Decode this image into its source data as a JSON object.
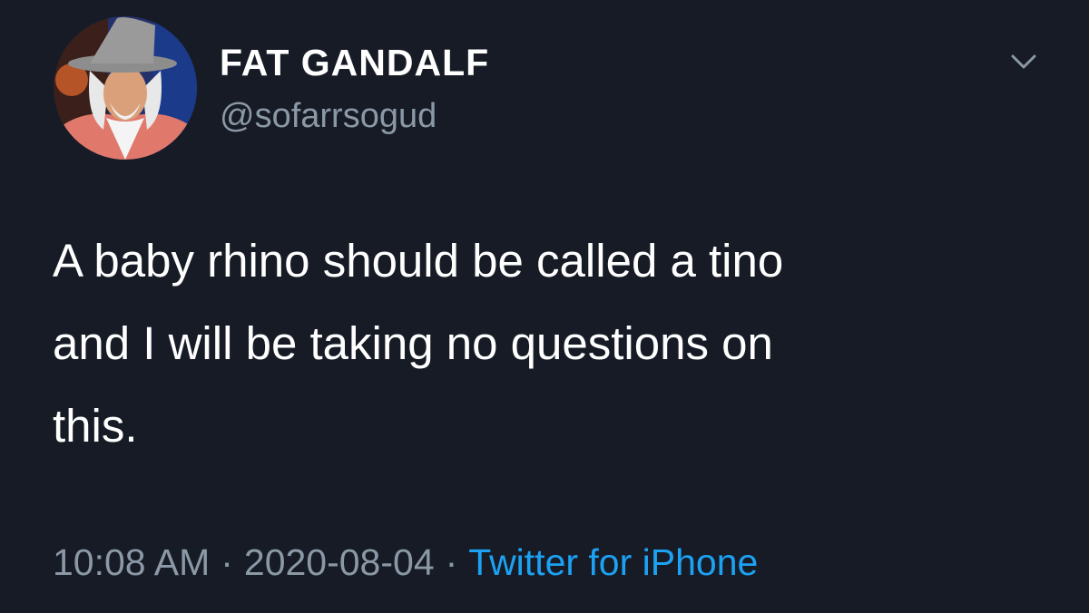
{
  "tweet": {
    "display_name": "FAT GANDALF",
    "handle": "@sofarrsogud",
    "text_lines": [
      "A baby rhino should be called a tino",
      "and I will be taking no questions on",
      "this."
    ],
    "time": "10:08 AM",
    "separator": "·",
    "date": "2020-08-04",
    "source": "Twitter for iPhone"
  },
  "icons": {
    "menu": "chevron-down-icon",
    "avatar": "avatar"
  },
  "colors": {
    "background": "#161b26",
    "text_primary": "#ffffff",
    "text_secondary": "#8b98a5",
    "link": "#1da1f2"
  }
}
